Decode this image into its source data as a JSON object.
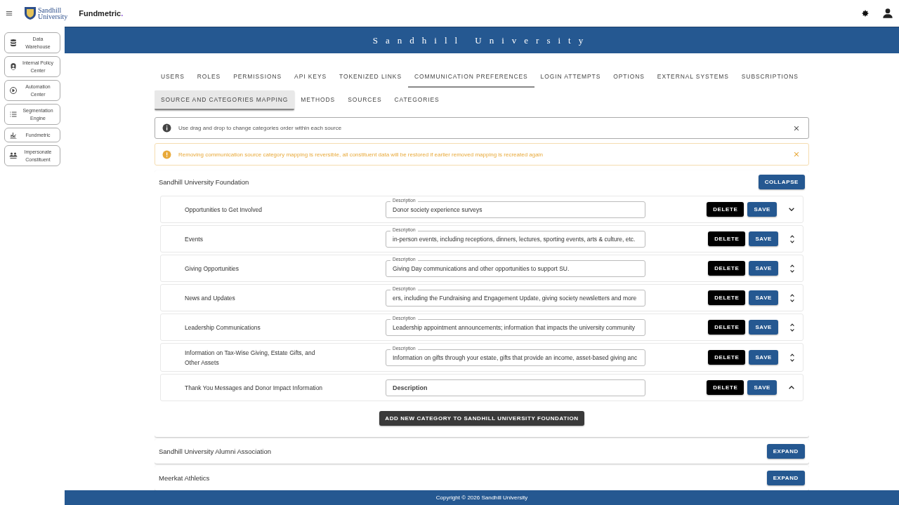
{
  "header": {
    "logo_line1": "Sandhill",
    "logo_line2": "University",
    "brand": "Fundmetric",
    "brand_dot": "."
  },
  "sidebar": {
    "items": [
      {
        "label": "Data Warehouse",
        "kind": "database"
      },
      {
        "label": "Internal Policy Center",
        "kind": "policy"
      },
      {
        "label": "Automation Center",
        "kind": "play"
      },
      {
        "label": "Segmentation Engine",
        "kind": "list"
      },
      {
        "label": "Fundmetric",
        "kind": "chart"
      },
      {
        "label": "Impersonate Constituent",
        "kind": "people"
      }
    ]
  },
  "banner": {
    "title": "Sandhill University"
  },
  "tabs": [
    {
      "label": "USERS",
      "selected": false
    },
    {
      "label": "ROLES",
      "selected": false
    },
    {
      "label": "PERMISSIONS",
      "selected": false
    },
    {
      "label": "API KEYS",
      "selected": false
    },
    {
      "label": "TOKENIZED LINKS",
      "selected": false
    },
    {
      "label": "COMMUNICATION PREFERENCES",
      "selected": true
    },
    {
      "label": "LOGIN ATTEMPTS",
      "selected": false
    },
    {
      "label": "OPTIONS",
      "selected": false
    },
    {
      "label": "EXTERNAL SYSTEMS",
      "selected": false
    },
    {
      "label": "SUBSCRIPTIONS",
      "selected": false
    }
  ],
  "subtabs": [
    {
      "label": "SOURCE AND CATEGORIES MAPPING",
      "selected": true
    },
    {
      "label": "METHODS",
      "selected": false
    },
    {
      "label": "SOURCES",
      "selected": false
    },
    {
      "label": "CATEGORIES",
      "selected": false
    }
  ],
  "alerts": [
    {
      "kind": "info",
      "text": "Use drag and drop to change categories order within each source"
    },
    {
      "kind": "warning",
      "text": "Removing communication source category mapping is reversible, all constituent data will be restored if earlier removed mapping is recreated again"
    }
  ],
  "sources": [
    {
      "name": "Sandhill University Foundation",
      "expanded": true,
      "toggle": "COLLAPSE",
      "add_button": "ADD NEW CATEGORY TO SANDHILL UNIVERSITY FOUNDATION",
      "categories": [
        {
          "name": "Opportunities to Get Involved",
          "label": "Description",
          "value": "Donor society experience surveys",
          "kind": "down",
          "delete": "DELETE",
          "save": "SAVE"
        },
        {
          "name": "Events",
          "label": "Description",
          "value": "in-person events, including receptions, dinners, lectures, sporting events, arts & culture, etc.",
          "kind": "updown",
          "delete": "DELETE",
          "save": "SAVE"
        },
        {
          "name": "Giving Opportunities",
          "label": "Description",
          "value": "Giving Day communications and other opportunities to support SU.",
          "kind": "updown",
          "delete": "DELETE",
          "save": "SAVE"
        },
        {
          "name": "News and Updates",
          "label": "Description",
          "value": "ers, including the Fundraising and Engagement Update, giving society newsletters and more",
          "kind": "updown",
          "delete": "DELETE",
          "save": "SAVE"
        },
        {
          "name": "Leadership Communications",
          "label": "Description",
          "value": "Leadership appointment announcements; information that impacts the university community",
          "kind": "updown",
          "delete": "DELETE",
          "save": "SAVE"
        },
        {
          "name": "Information on Tax-Wise Giving, Estate Gifts, and Other Assets",
          "label": "Description",
          "value": "Information on gifts through your estate, gifts that provide an income, asset-based giving anc",
          "kind": "updown",
          "delete": "DELETE",
          "save": "SAVE"
        },
        {
          "name": "Thank You Messages and Donor Impact Information",
          "label": "Description",
          "kind": "up",
          "delete": "DELETE",
          "save": "SAVE"
        }
      ]
    },
    {
      "name": "Sandhill University Alumni Association",
      "expanded": false,
      "toggle": "EXPAND"
    },
    {
      "name": "Meerkat Athletics",
      "expanded": false,
      "toggle": "EXPAND"
    }
  ],
  "footer": {
    "text": "Copyright © 2026 Sandhill University"
  }
}
